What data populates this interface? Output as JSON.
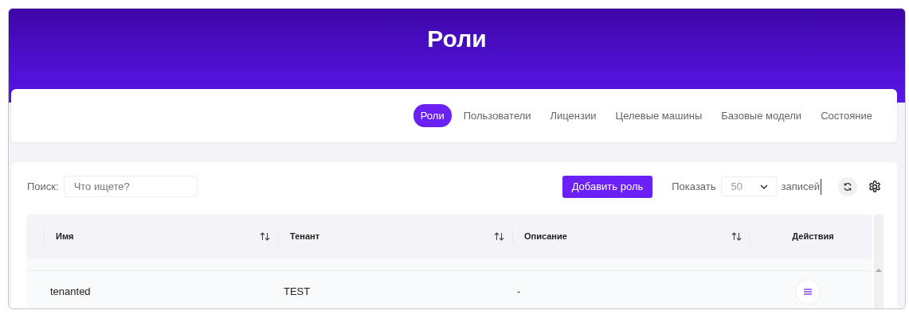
{
  "header": {
    "title": "Роли"
  },
  "tabs": [
    {
      "label": "Роли",
      "selected": true
    },
    {
      "label": "Пользователи",
      "selected": false
    },
    {
      "label": "Лицензии",
      "selected": false
    },
    {
      "label": "Целевые машины",
      "selected": false
    },
    {
      "label": "Базовые модели",
      "selected": false
    },
    {
      "label": "Состояние",
      "selected": false
    }
  ],
  "search": {
    "label": "Поиск:",
    "placeholder": "Что ищете?"
  },
  "add_button": "Добавить роль",
  "page_size": {
    "label": "Показать",
    "value": "50",
    "suffix": "записей"
  },
  "table": {
    "columns": [
      {
        "label": "Имя",
        "sortable": true
      },
      {
        "label": "Тенант",
        "sortable": true
      },
      {
        "label": "Описание",
        "sortable": true
      },
      {
        "label": "Действия",
        "sortable": false
      }
    ],
    "rows": [
      {
        "cells": [
          "tenanted",
          "TEST",
          "-"
        ]
      }
    ]
  }
}
